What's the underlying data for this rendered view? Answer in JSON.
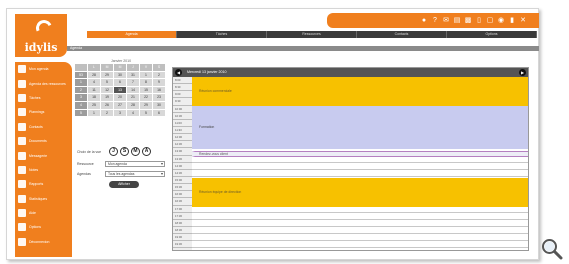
{
  "app": {
    "logo_text": "idylis",
    "brand_color": "#f07f1e"
  },
  "toolbar_icons": [
    "user-icon",
    "help-icon",
    "mail-icon",
    "document-icon",
    "print-icon",
    "file-icon",
    "envelope-icon",
    "globe-icon",
    "folder-icon",
    "tools-icon"
  ],
  "menu": [
    {
      "label": "Agenda",
      "active": true
    },
    {
      "label": "Tâches",
      "active": false
    },
    {
      "label": "Ressources",
      "active": false
    },
    {
      "label": "Contacts",
      "active": false
    },
    {
      "label": "Options",
      "active": false
    }
  ],
  "breadcrumb": "Agenda",
  "sidebar": [
    "Mon agenda",
    "Agenda des ressources",
    "Tâches",
    "Plannings",
    "Contacts",
    "Documents",
    "Messagerie",
    "Notes",
    "Rapports",
    "Statistiques",
    "Aide",
    "Options",
    "Déconnexion"
  ],
  "calendar": {
    "month": "Janvier 2010",
    "dow": [
      "",
      "L",
      "M",
      "M",
      "J",
      "V",
      "S"
    ],
    "weeks": [
      [
        "53",
        "28",
        "29",
        "30",
        "31",
        "1",
        "2"
      ],
      [
        "1",
        "4",
        "5",
        "6",
        "7",
        "8",
        "9"
      ],
      [
        "2",
        "11",
        "12",
        "13",
        "14",
        "15",
        "16"
      ],
      [
        "3",
        "18",
        "19",
        "20",
        "21",
        "22",
        "23"
      ],
      [
        "4",
        "25",
        "26",
        "27",
        "28",
        "29",
        "30"
      ],
      [
        "5",
        "1",
        "2",
        "3",
        "4",
        "5",
        "6"
      ]
    ],
    "selected": "13"
  },
  "view_nav": {
    "label": "Choix de la vue",
    "buttons": [
      "J",
      "S",
      "M",
      "A"
    ]
  },
  "form": {
    "rows": [
      {
        "label": "Ressource",
        "value": "Mon agenda"
      },
      {
        "label": "Agendas",
        "value": "Tous les agendas"
      }
    ],
    "button": "Afficher"
  },
  "planner": {
    "title": "Mercredi 13 janvier 2010",
    "times": [
      "8:00",
      "8:30",
      "9:00",
      "9:30",
      "10:00",
      "10:30",
      "11:00",
      "11:30",
      "12:00",
      "12:30",
      "13:00",
      "13:30",
      "14:00",
      "14:30",
      "15:00",
      "15:30",
      "16:00",
      "16:30",
      "17:00",
      "17:30",
      "18:00",
      "18:30",
      "19:00",
      "19:30"
    ],
    "events": [
      {
        "text": "Réunion commerciale",
        "style": "yellow"
      },
      {
        "text": "Formation",
        "style": "purple"
      },
      {
        "text": "Rendez-vous client",
        "style": "thin"
      },
      {
        "text": "Réunion équipe de direction",
        "style": "yellow"
      }
    ]
  }
}
